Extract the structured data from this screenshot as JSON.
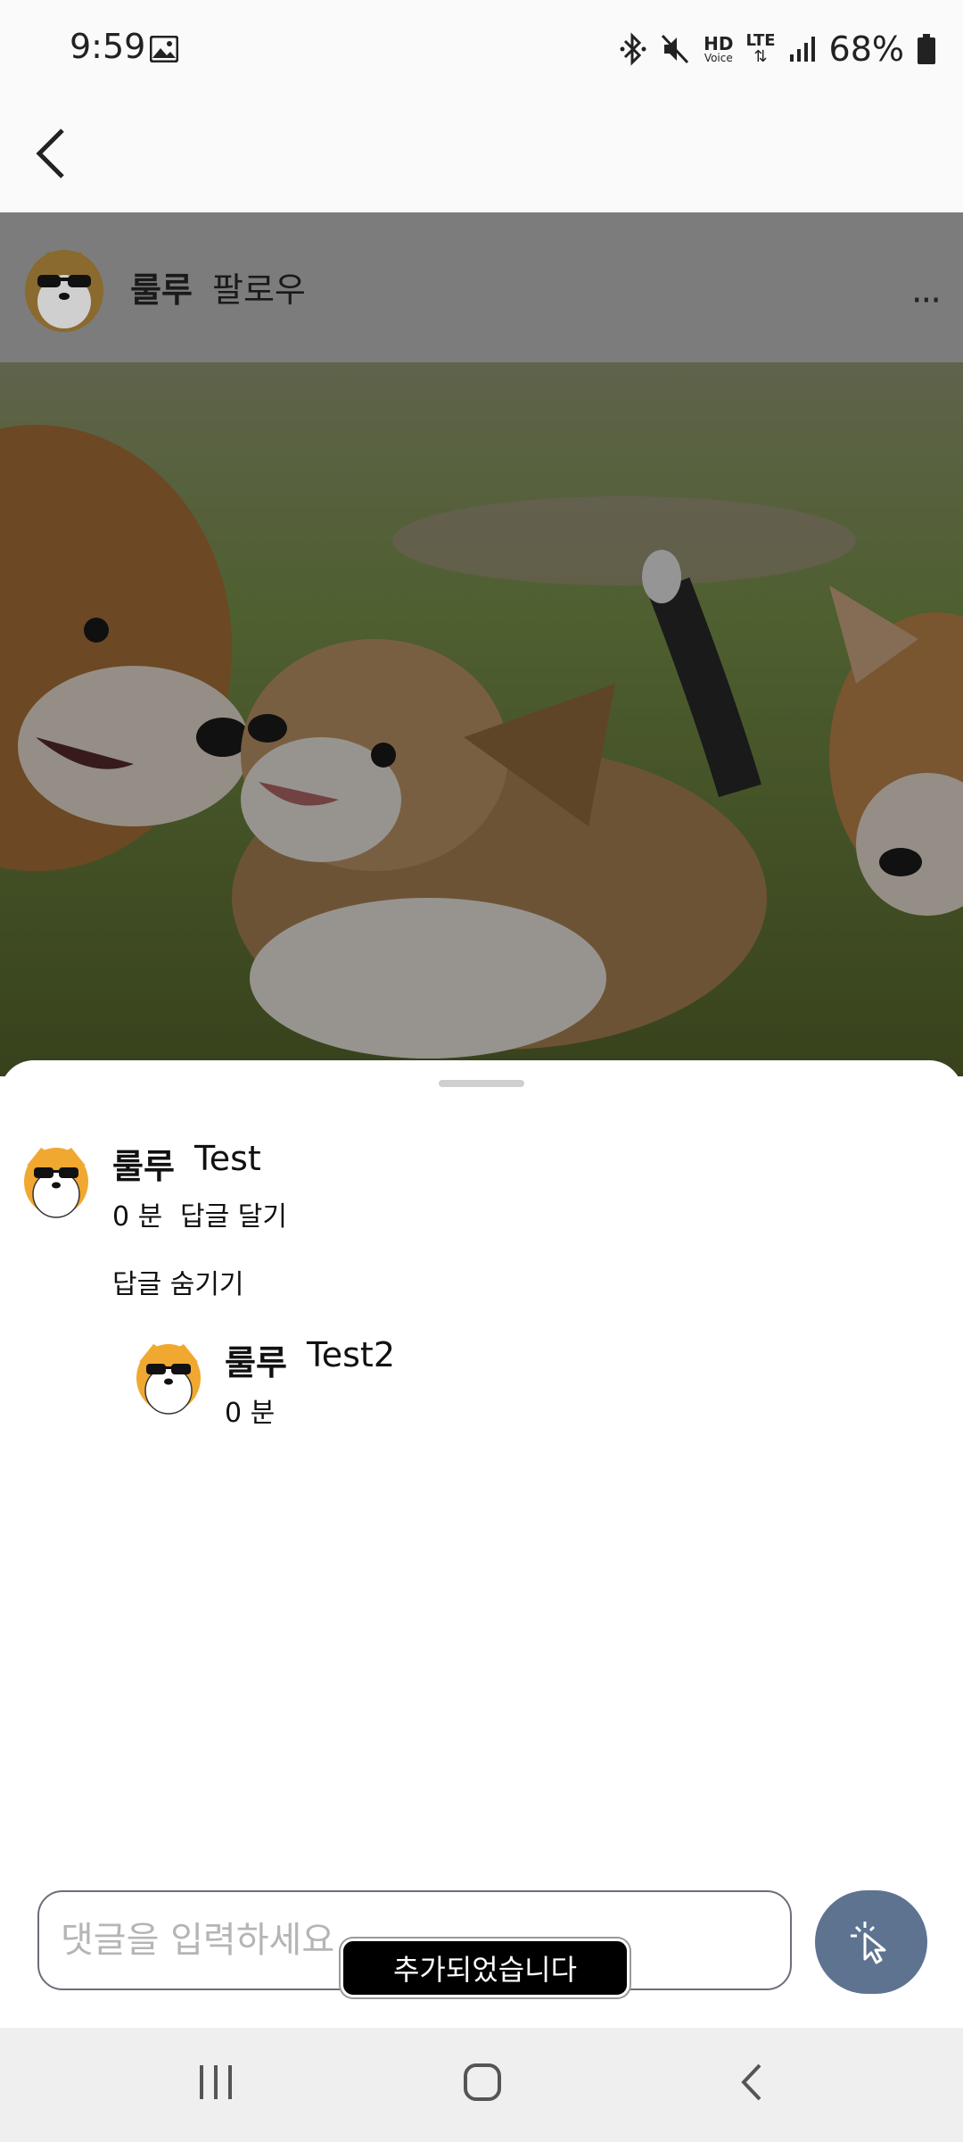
{
  "status_bar": {
    "time": "9:59",
    "network_hd": "HD",
    "network_voice": "Voice",
    "network_lte": "LTE",
    "battery": "68%"
  },
  "post": {
    "username": "룰루",
    "follow_label": "팔로우",
    "more_label": "···"
  },
  "comments": [
    {
      "author": "룰루",
      "text": "Test",
      "time": "0 분",
      "reply_label": "답글 달기",
      "hide_replies_label": "답글 숨기기",
      "replies": [
        {
          "author": "룰루",
          "text": "Test2",
          "time": "0 분"
        }
      ]
    }
  ],
  "composer": {
    "placeholder": "댓글을 입력하세요",
    "value": ""
  },
  "toast": {
    "message": "추가되었습니다"
  },
  "colors": {
    "send_button": "#5e7390",
    "header_overlay": "#7c7c7c",
    "nav_bar": "#efefef"
  },
  "icons": {
    "back": "chevron-left-icon",
    "more": "more-horizontal-icon",
    "send": "cursor-click-icon"
  }
}
